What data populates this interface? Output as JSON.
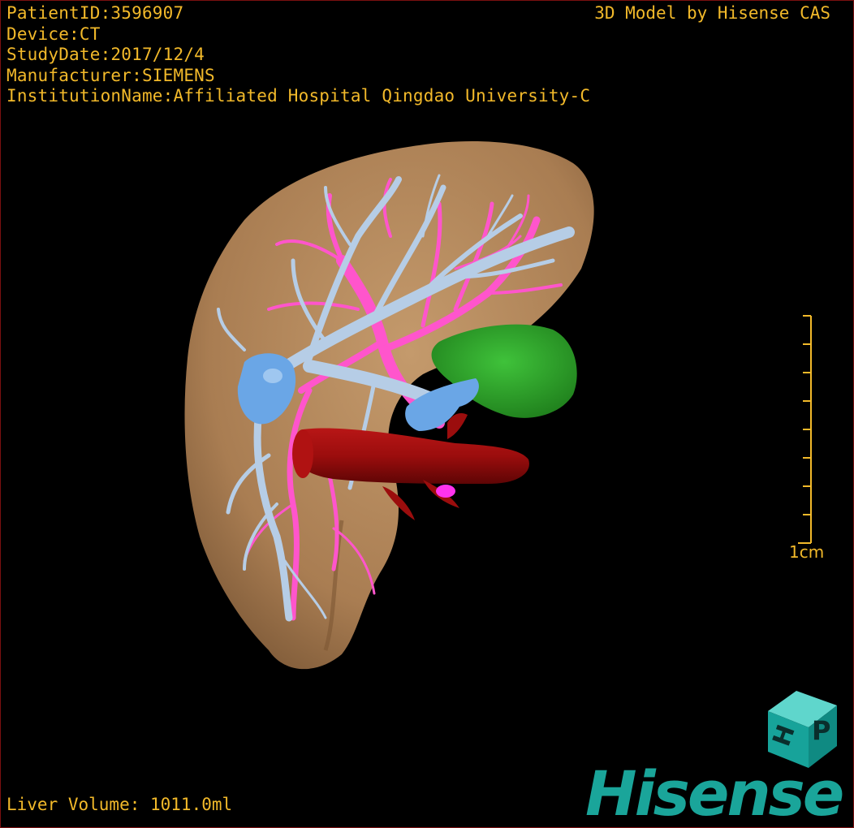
{
  "study_info": {
    "patient_id": "PatientID:3596907",
    "device": "Device:CT",
    "study_date": "StudyDate:2017/12/4",
    "manufacturer": "Manufacturer:SIEMENS",
    "institution": "InstitutionName:Affiliated Hospital Qingdao University-C"
  },
  "model_credit": "3D Model by Hisense CAS",
  "liver_volume": "Liver Volume: 1011.0ml",
  "scale_bar": {
    "label": "1cm"
  },
  "brand": {
    "name": "Hisense",
    "cube_letters": [
      "H",
      "P"
    ]
  },
  "colors": {
    "overlay_text": "#f2b92a",
    "liver": "#b5875a",
    "hepatic_vein": "#b6cde6",
    "portal_vein": "#ff55cc",
    "ivc": "#9b0d0d",
    "gallbladder": "#2ea82a",
    "portal_trunk": "#6aa6e6",
    "brand": "#1aa59a"
  }
}
